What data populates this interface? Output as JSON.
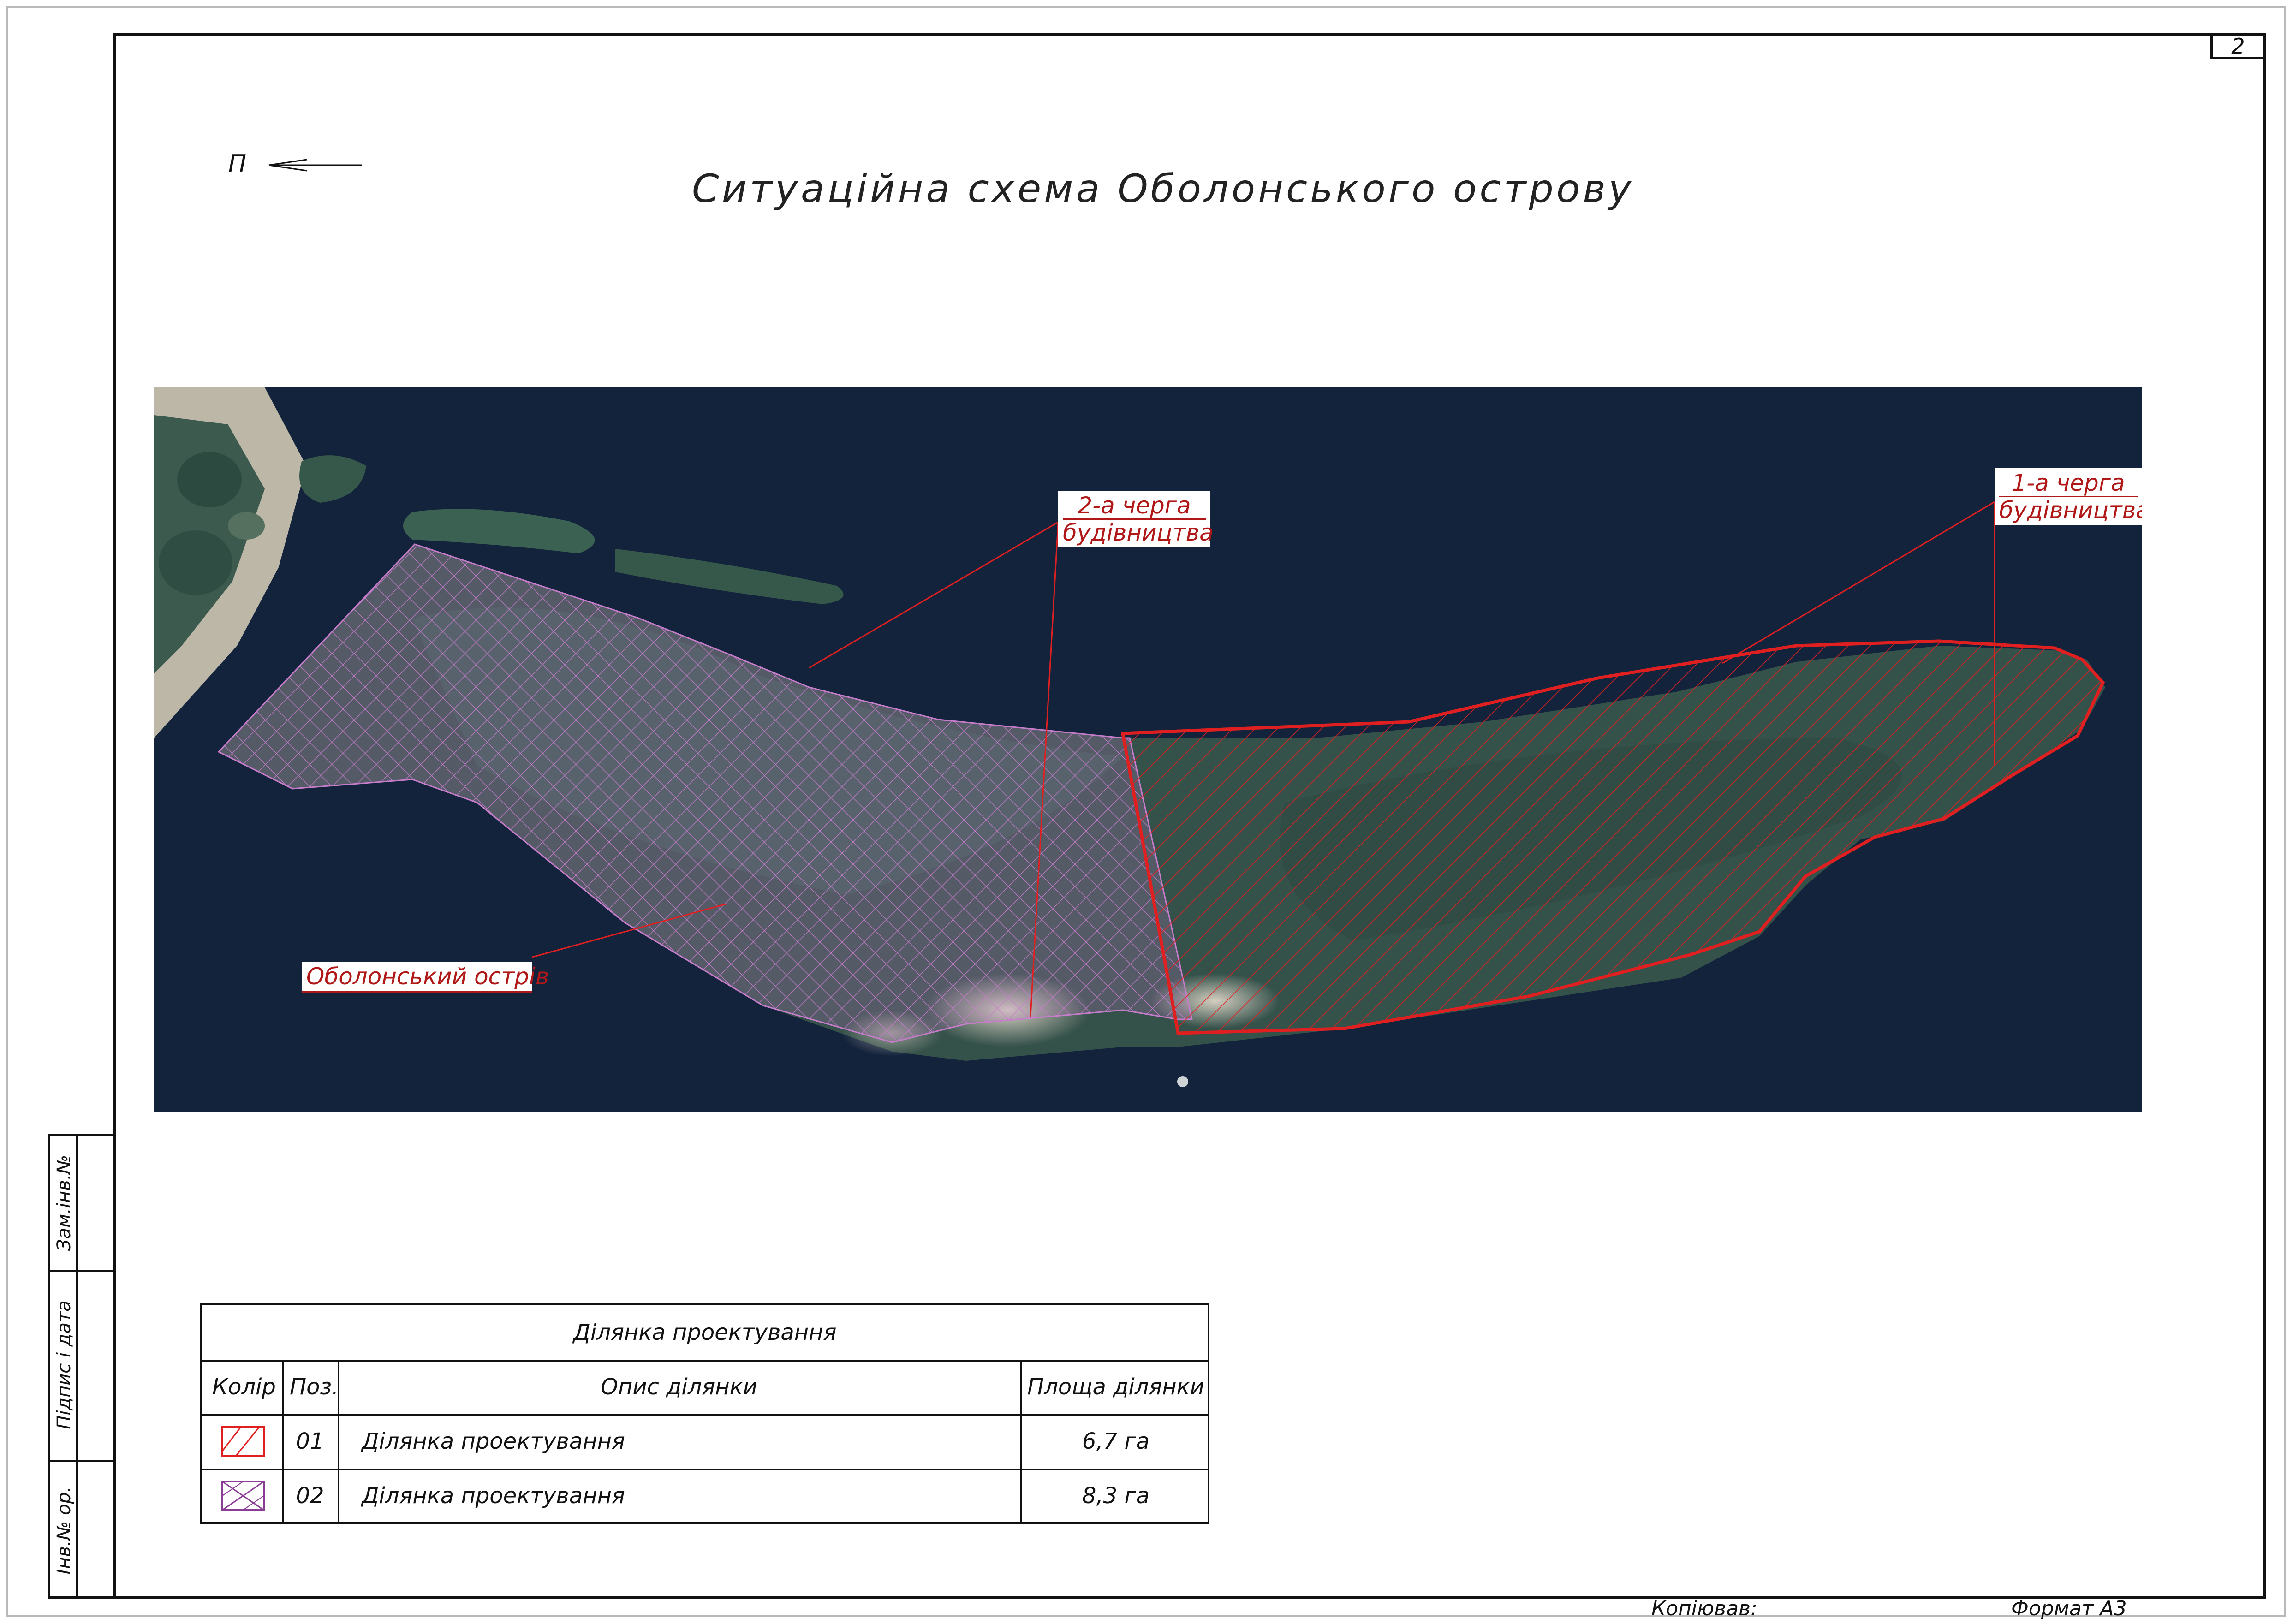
{
  "sheet_number": "2",
  "title": "Ситуаційна схема Оболонського острову",
  "north_letter": "П",
  "map": {
    "label_stage2": {
      "line1": "2-а черга",
      "line2": "будівництва"
    },
    "label_stage1": {
      "line1": "1-а черга",
      "line2": "будівництва"
    },
    "label_island": "Оболонський острів"
  },
  "legend": {
    "title": "Ділянка проектування",
    "headers": {
      "color": "Колір",
      "pos": "Поз.",
      "desc": "Опис ділянки",
      "area": "Площа ділянки"
    },
    "rows": [
      {
        "pos": "01",
        "desc": "Ділянка проектування",
        "area": "6,7 га",
        "swatch": "red-hatch"
      },
      {
        "pos": "02",
        "desc": "Ділянка проектування",
        "area": "8,3 га",
        "swatch": "purple-crosshatch"
      }
    ]
  },
  "stamp": {
    "replaced_inv": "Зам.інв.№",
    "sign_date": "Підпис і дата",
    "inv_orig": "Інв.№ ор."
  },
  "footer": {
    "copied": "Копіював:",
    "format": "Формат А3"
  },
  "colors": {
    "water": "#13233c",
    "stage1": "#e02020",
    "stage2": "#c77ccc",
    "label_text": "#b01818"
  }
}
